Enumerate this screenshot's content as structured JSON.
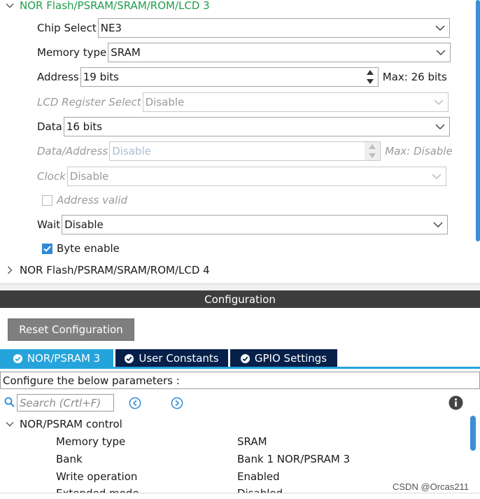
{
  "groups": {
    "nor3": "NOR Flash/PSRAM/SRAM/ROM/LCD 3",
    "nor4": "NOR Flash/PSRAM/SRAM/ROM/LCD 4"
  },
  "params": {
    "chip_select": {
      "label": "Chip Select",
      "value": "NE3"
    },
    "memory_type": {
      "label": "Memory type",
      "value": "SRAM"
    },
    "address": {
      "label": "Address",
      "value": "19 bits",
      "max": "Max: 26 bits"
    },
    "lcd_register_select": {
      "label": "LCD Register Select",
      "value": "Disable"
    },
    "data": {
      "label": "Data",
      "value": "16 bits"
    },
    "data_address": {
      "label": "Data/Address",
      "value": "Disable",
      "max": "Max: Disable"
    },
    "clock": {
      "label": "Clock",
      "value": "Disable"
    },
    "address_valid": {
      "label": "Address valid",
      "checked": false
    },
    "wait": {
      "label": "Wait",
      "value": "Disable"
    },
    "byte_enable": {
      "label": "Byte enable",
      "checked": true
    }
  },
  "configuration": {
    "title": "Configuration",
    "reset_label": "Reset Configuration",
    "tabs": [
      {
        "label": "NOR/PSRAM 3",
        "active": true
      },
      {
        "label": "User Constants",
        "active": false
      },
      {
        "label": "GPIO Settings",
        "active": false
      }
    ],
    "caption": "Configure the below parameters :",
    "search_placeholder": "Search (Crtl+F)",
    "tree_title": "NOR/PSRAM control",
    "rows": [
      {
        "key": "Memory type",
        "value": "SRAM"
      },
      {
        "key": "Bank",
        "value": "Bank 1 NOR/PSRAM 3"
      },
      {
        "key": "Write operation",
        "value": "Enabled"
      },
      {
        "key": "Extended mode",
        "value": "Disabled"
      }
    ]
  },
  "watermark": "CSDN @Orcas211",
  "colors": {
    "group_open": "#1e9e4a",
    "tab_active": "#25a3db",
    "tab_inactive": "#06204a",
    "check_on": "#2f8ad6",
    "config_bar": "#3e3e3e",
    "scrollbar": "#3a8fd8"
  },
  "icons": {
    "expanded": "chevron-down-icon",
    "collapsed": "chevron-right-icon",
    "dropdown": "chevron-down-icon",
    "spinner": "spinner-arrows-icon",
    "tab_status": "check-circle-icon",
    "search": "search-icon",
    "prev": "arrow-left-circle-icon",
    "next": "arrow-right-circle-icon",
    "info": "info-icon"
  }
}
